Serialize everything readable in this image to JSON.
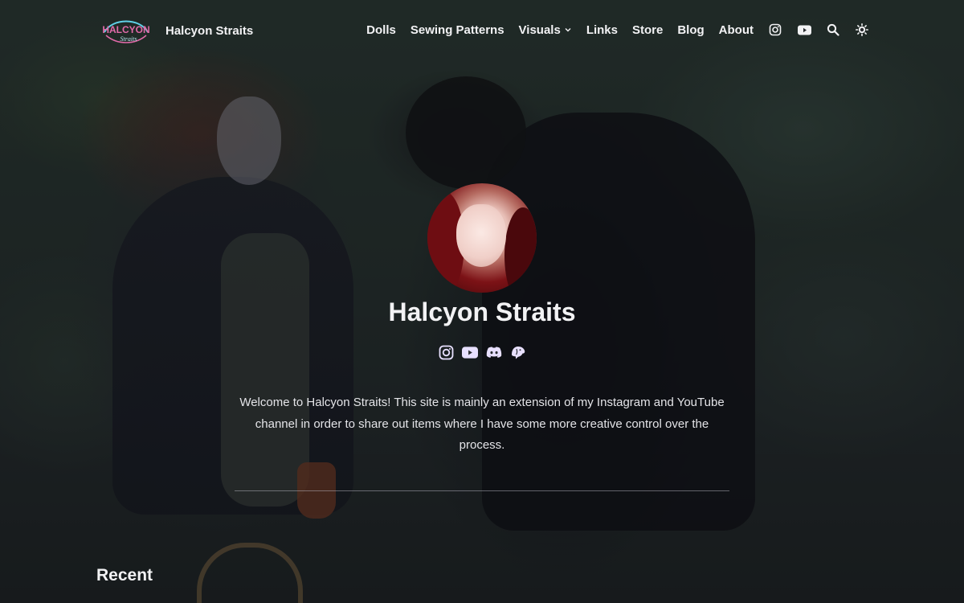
{
  "site": {
    "logo_text": "HALCYON",
    "logo_subtext": "Straits",
    "title": "Halcyon Straits"
  },
  "nav": {
    "items": [
      {
        "label": "Dolls"
      },
      {
        "label": "Sewing Patterns"
      },
      {
        "label": "Visuals",
        "has_dropdown": true
      },
      {
        "label": "Links"
      },
      {
        "label": "Store"
      },
      {
        "label": "Blog"
      },
      {
        "label": "About"
      }
    ],
    "icons": [
      "instagram-icon",
      "youtube-icon",
      "search-icon",
      "theme-toggle-icon"
    ]
  },
  "hero": {
    "title": "Halcyon Straits",
    "social_icons": [
      "instagram-icon",
      "youtube-icon",
      "discord-icon",
      "mastodon-icon"
    ],
    "intro": "Welcome to Halcyon Straits! This site is mainly an extension of my Instagram and YouTube channel in order to share out items where I have some more creative control over the process."
  },
  "sections": {
    "recent_heading": "Recent"
  },
  "colors": {
    "text": "#f2f2f4",
    "icon": "#e8e0ff",
    "logo_pink": "#e06aa8",
    "logo_cyan": "#5fd0e6"
  }
}
